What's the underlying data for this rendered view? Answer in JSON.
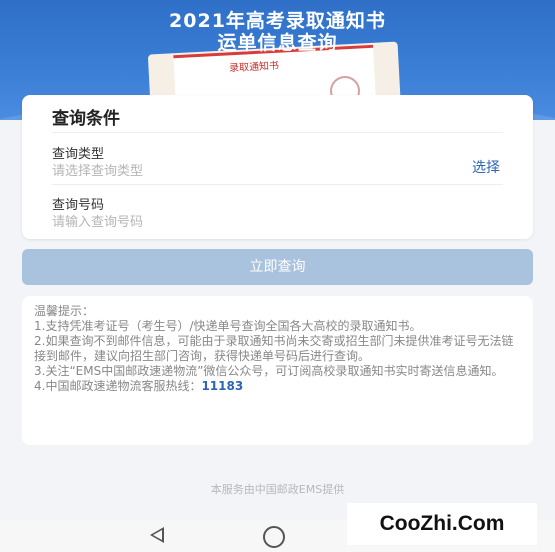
{
  "banner": {
    "title_line1": "2021年高考录取通知书",
    "title_line2": "运单信息查询",
    "letter_tag": "录取通知书"
  },
  "query_card": {
    "title": "查询条件",
    "type_label": "查询类型",
    "type_placeholder": "请选择查询类型",
    "select_label": "选择",
    "number_label": "查询号码",
    "number_placeholder": "请输入查询号码"
  },
  "submit_button": "立即查询",
  "tips": {
    "heading": "温馨提示：",
    "items": [
      "1.支持凭准考证号（考生号）/快递单号查询全国各大高校的录取通知书。",
      "2.如果查询不到邮件信息，可能由于录取通知书尚未交寄或招生部门未提供准考证号无法链接到邮件，建议向招生部门咨询，获得快递单号码后进行查询。",
      "3.关注“EMS中国邮政速递物流”微信公众号，可订阅高校录取通知书实时寄送信息通知。"
    ],
    "hotline_prefix": "4.中国邮政速递物流客服热线：",
    "hotline_number": "11183"
  },
  "footer": "本服务由中国邮政EMS提供",
  "watermark": "CooZhi.Com",
  "nav": {
    "back_icon": "back-triangle-icon",
    "home_icon": "home-circle-icon"
  }
}
